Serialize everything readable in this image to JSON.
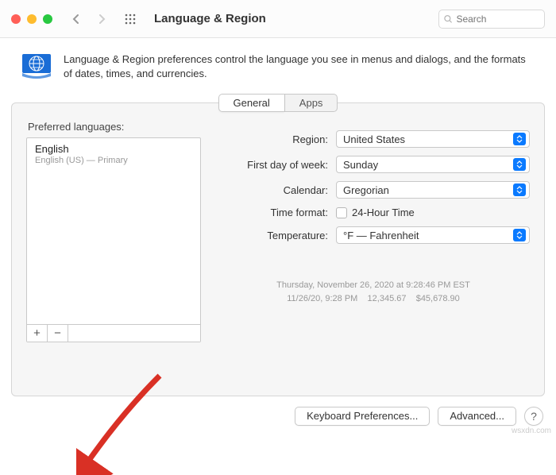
{
  "titlebar": {
    "title": "Language & Region",
    "search_placeholder": "Search"
  },
  "header": {
    "description": "Language & Region preferences control the language you see in menus and dialogs, and the formats of dates, times, and currencies."
  },
  "tabs": {
    "general": "General",
    "apps": "Apps",
    "active": "General"
  },
  "preferred": {
    "label": "Preferred languages:",
    "items": [
      {
        "name": "English",
        "sub": "English (US) — Primary"
      }
    ],
    "add_label": "+",
    "remove_label": "−"
  },
  "settings": {
    "region_label": "Region:",
    "region_value": "United States",
    "first_day_label": "First day of week:",
    "first_day_value": "Sunday",
    "calendar_label": "Calendar:",
    "calendar_value": "Gregorian",
    "time_format_label": "Time format:",
    "time_format_checkbox": "24-Hour Time",
    "temperature_label": "Temperature:",
    "temperature_value": "°F — Fahrenheit"
  },
  "sample": {
    "line1": "Thursday, November 26, 2020 at 9:28:46 PM EST",
    "line2": "11/26/20, 9:28 PM    12,345.67    $45,678.90"
  },
  "footer": {
    "keyboard": "Keyboard Preferences...",
    "advanced": "Advanced...",
    "help": "?"
  },
  "watermark": "wsxdn.com"
}
